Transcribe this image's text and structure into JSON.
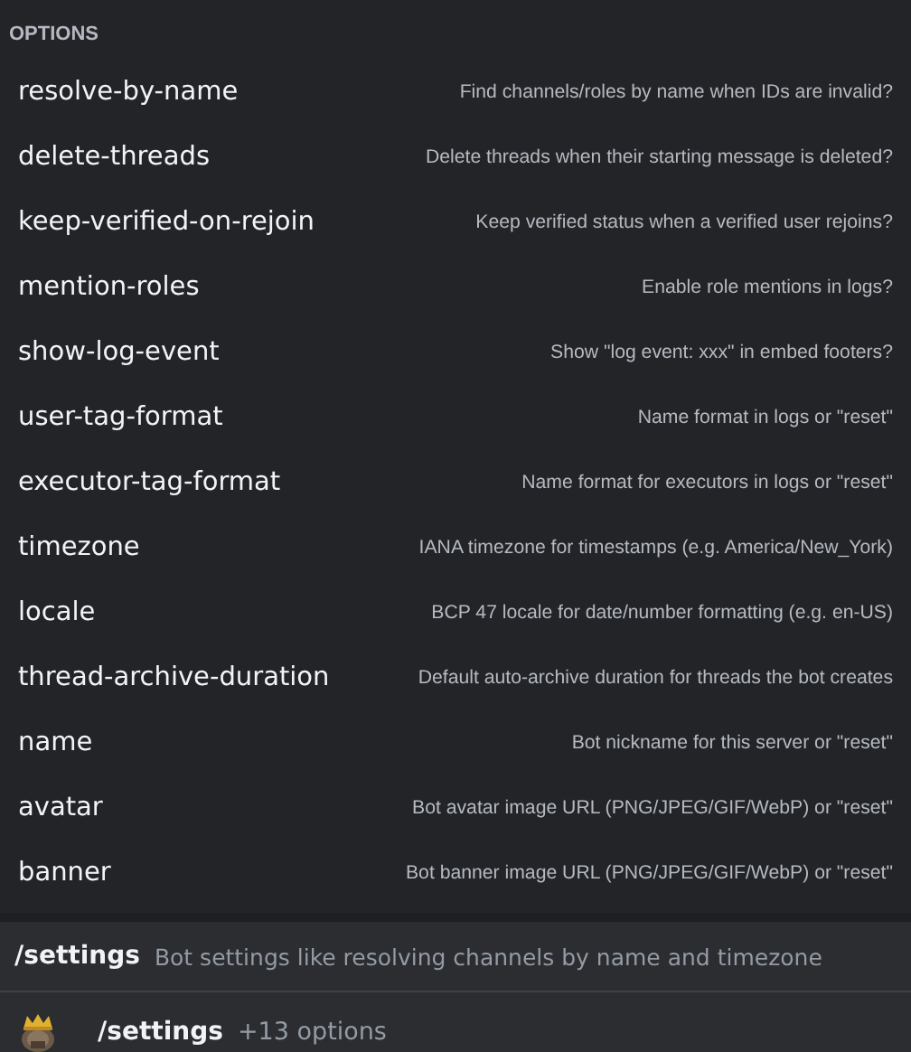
{
  "options_panel": {
    "heading": "OPTIONS",
    "options": [
      {
        "name": "resolve-by-name",
        "description": "Find channels/roles by name when IDs are invalid?"
      },
      {
        "name": "delete-threads",
        "description": "Delete threads when their starting message is deleted?"
      },
      {
        "name": "keep-verified-on-rejoin",
        "description": "Keep verified status when a verified user rejoins?"
      },
      {
        "name": "mention-roles",
        "description": "Enable role mentions in logs?"
      },
      {
        "name": "show-log-event",
        "description": "Show \"log event: xxx\" in embed footers?"
      },
      {
        "name": "user-tag-format",
        "description": "Name format in logs or \"reset\""
      },
      {
        "name": "executor-tag-format",
        "description": "Name format for executors in logs or \"reset\""
      },
      {
        "name": "timezone",
        "description": "IANA timezone for timestamps (e.g. America/New_York)"
      },
      {
        "name": "locale",
        "description": "BCP 47 locale for date/number formatting (e.g. en-US)"
      },
      {
        "name": "thread-archive-duration",
        "description": "Default auto-archive duration for threads the bot creates"
      },
      {
        "name": "name",
        "description": "Bot nickname for this server or \"reset\""
      },
      {
        "name": "avatar",
        "description": "Bot avatar image URL (PNG/JPEG/GIF/WebP) or \"reset\""
      },
      {
        "name": "banner",
        "description": "Bot banner image URL (PNG/JPEG/GIF/WebP) or \"reset\""
      }
    ]
  },
  "command_hint": {
    "command": "/settings",
    "description": "Bot settings like resolving channels by name and timezone"
  },
  "command_entry": {
    "command": "/settings",
    "options_count": "+13 options"
  }
}
